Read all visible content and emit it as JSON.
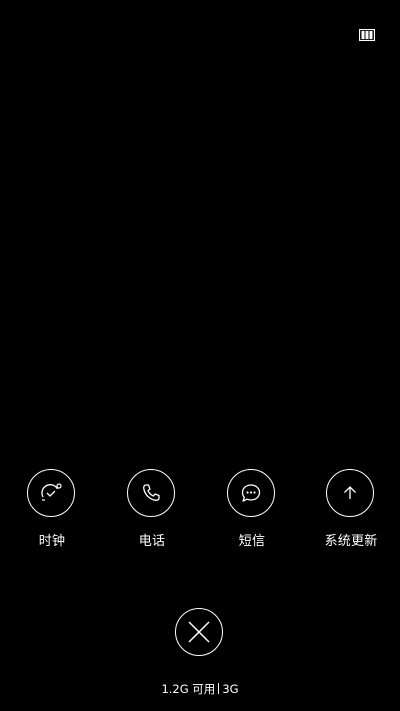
{
  "apps": [
    {
      "label": "时钟",
      "icon": "clock-icon"
    },
    {
      "label": "电话",
      "icon": "phone-icon"
    },
    {
      "label": "短信",
      "icon": "message-icon"
    },
    {
      "label": "系统更新",
      "icon": "arrow-up-icon"
    }
  ],
  "memory": {
    "available": "1.2G 可用",
    "total": "3G"
  },
  "colors": {
    "background": "#000000",
    "foreground": "#ffffff"
  },
  "icons": {
    "top_right": "lock-recents-icon",
    "close": "close-icon"
  }
}
